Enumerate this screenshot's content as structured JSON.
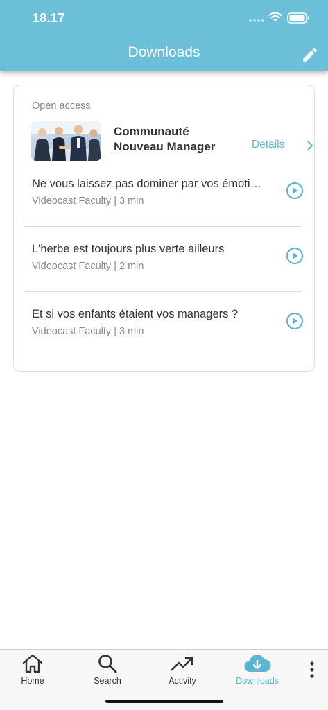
{
  "status_bar": {
    "time": "18.17"
  },
  "header": {
    "title": "Downloads"
  },
  "card": {
    "section_label": "Open access",
    "community": {
      "name_line1": "Communauté",
      "name_line2": "Nouveau Manager",
      "details_label": "Details"
    },
    "items": [
      {
        "title": "Ne vous laissez pas dominer par vos émotions",
        "subtitle": "Videocast Faculty | 3 min"
      },
      {
        "title": "L'herbe est toujours plus verte ailleurs",
        "subtitle": "Videocast Faculty | 2 min"
      },
      {
        "title": "Et si vos enfants étaient vos managers ?",
        "subtitle": "Videocast Faculty | 3 min"
      }
    ]
  },
  "tabbar": {
    "tabs": [
      {
        "label": "Home",
        "icon": "home-icon"
      },
      {
        "label": "Search",
        "icon": "search-icon"
      },
      {
        "label": "Activity",
        "icon": "activity-icon"
      },
      {
        "label": "Downloads",
        "icon": "cloud-download-icon",
        "active": true
      }
    ],
    "more_icon": "more-vertical-icon"
  },
  "colors": {
    "header_bg": "#6bbfd8",
    "accent": "#5ab4d2",
    "text": "#333333",
    "muted": "#8a8a8a"
  }
}
